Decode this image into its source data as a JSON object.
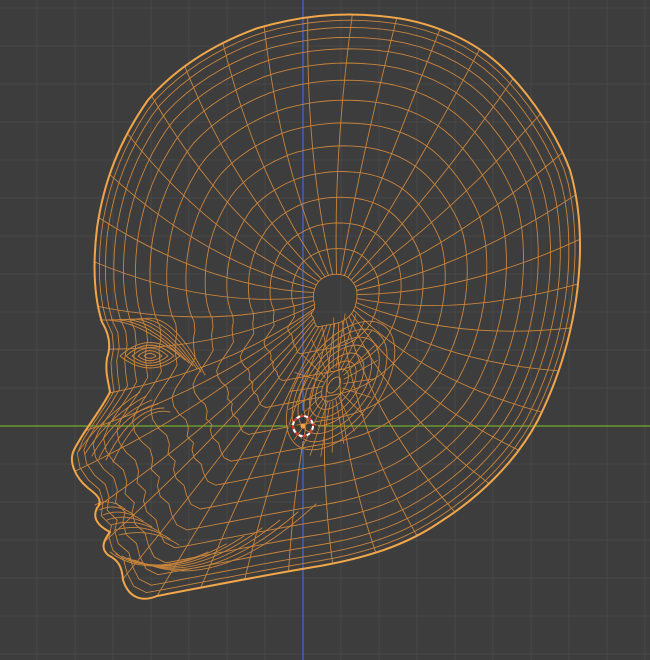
{
  "viewport": {
    "background_color": "#3d3d3d",
    "grid_color": "#484848",
    "x_axis_color": "#6a9a2c",
    "z_axis_color": "#3d62b3",
    "selection_wire_color": "#f0a64a",
    "mesh_wire_color": "#c9843c",
    "cursor_ring_color_1": "#ffffff",
    "cursor_ring_color_2": "#d93838",
    "origin_dot_color": "#f2a24b"
  },
  "object": {
    "icon": "3d-cursor-icon",
    "mesh": "head-wireframe"
  }
}
